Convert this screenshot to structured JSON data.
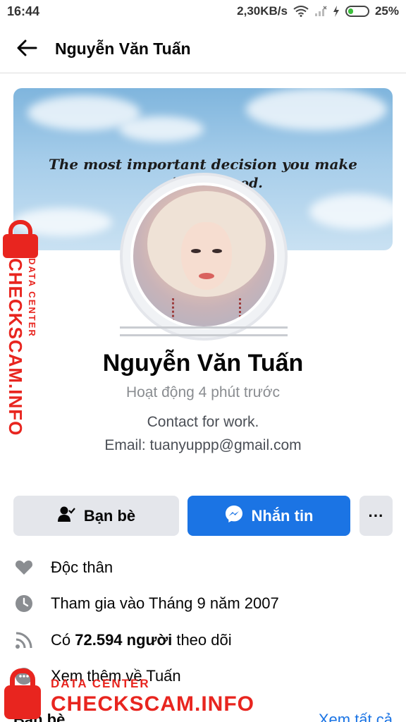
{
  "status_bar": {
    "time": "16:44",
    "network_speed": "2,30KB/s",
    "battery_percent": "25%"
  },
  "header": {
    "title": "Nguyễn Văn Tuấn"
  },
  "cover": {
    "quote_line1": "The most important decision you make",
    "quote_line2": "is to be          ood."
  },
  "profile": {
    "name": "Nguyễn Văn Tuấn",
    "activity": "Hoạt động 4 phút trước",
    "bio_line1": "Contact for work.",
    "bio_line2": "Email: tuanyuppp@gmail.com"
  },
  "actions": {
    "friends_label": "Bạn bè",
    "message_label": "Nhắn tin",
    "more_label": "···"
  },
  "info": {
    "relationship": "Độc thân",
    "joined": "Tham gia vào Tháng 9 năm 2007",
    "followers_prefix": "Có ",
    "followers_count": "72.594 người",
    "followers_suffix": " theo dõi",
    "see_more": "Xem thêm về Tuấn"
  },
  "friends_section": {
    "title": "Bạn bè",
    "see_all": "Xem tất cả"
  },
  "watermark": {
    "data_center": "DATA CENTER",
    "brand": "CHECKSCAM.INFO"
  },
  "icons": {
    "back": "arrow-left-icon",
    "wifi": "wifi-icon",
    "signal": "signal-icon",
    "charging": "charging-icon",
    "battery": "battery-icon",
    "friends": "person-check-icon",
    "messenger": "messenger-icon",
    "relationship": "heart-icon",
    "joined": "clock-icon",
    "followers": "rss-icon",
    "see_more": "info-icon"
  },
  "colors": {
    "accent": "#1b74e4",
    "button_gray": "#e4e6eb",
    "watermark_red": "#e8251f"
  }
}
